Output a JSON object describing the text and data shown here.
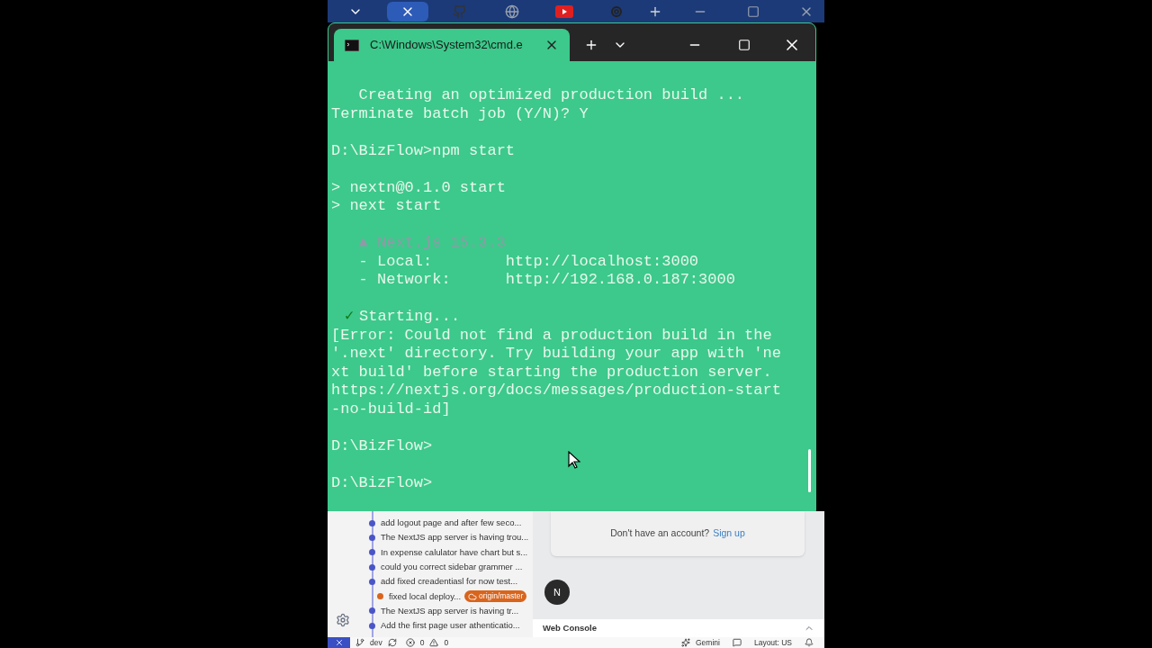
{
  "browser_tabs": [
    {
      "kind": "chevron",
      "selected": false
    },
    {
      "kind": "close",
      "selected": true
    },
    {
      "kind": "github",
      "selected": false
    },
    {
      "kind": "globe",
      "selected": false
    },
    {
      "kind": "youtube",
      "selected": false
    },
    {
      "kind": "knot",
      "selected": false
    }
  ],
  "terminal": {
    "tab_title": "C:\\Windows\\System32\\cmd.e",
    "blocks": [
      [
        {
          "kind": "normal",
          "text": "   Creating an optimized production build ..."
        },
        {
          "kind": "normal",
          "text": "Terminate batch job (Y/N)? Y"
        }
      ],
      [
        {
          "kind": "normal",
          "text": "D:\\BizFlow>npm start"
        }
      ],
      [
        {
          "kind": "normal",
          "text": "> nextn@0.1.0 start"
        },
        {
          "kind": "normal",
          "text": "> next start"
        }
      ],
      [
        {
          "kind": "faded",
          "text": "   ▲ Next.js 15.3.3"
        },
        {
          "kind": "normal",
          "text": "   - Local:        http://localhost:3000"
        },
        {
          "kind": "normal",
          "text": "   - Network:      http://192.168.0.187:3000"
        }
      ],
      [
        {
          "kind": "success",
          "mark": "✓",
          "text": "Starting..."
        },
        {
          "kind": "normal",
          "text": "[Error: Could not find a production build in the"
        },
        {
          "kind": "normal",
          "text": "'.next' directory. Try building your app with 'ne"
        },
        {
          "kind": "normal",
          "text": "xt build' before starting the production server."
        },
        {
          "kind": "normal",
          "text": "https://nextjs.org/docs/messages/production-start"
        },
        {
          "kind": "normal",
          "text": "-no-build-id]"
        }
      ],
      [
        {
          "kind": "normal",
          "text": "D:\\BizFlow>"
        }
      ],
      [
        {
          "kind": "normal",
          "text": "D:\\BizFlow>"
        }
      ]
    ]
  },
  "commits": [
    {
      "message": "add logout page and after few seco..."
    },
    {
      "message": "The NextJS app server is having trou..."
    },
    {
      "message": "In expense calulator have chart but s..."
    },
    {
      "message": "could you correct sidebar grammer ..."
    },
    {
      "message": "add fixed creadentiasl for now test..."
    },
    {
      "message": "fixed local deploy...",
      "branch": "origin/master"
    },
    {
      "message": "The NextJS app server is having tr..."
    },
    {
      "message": "Add the first page user athenticatio..."
    }
  ],
  "signup": {
    "prompt": "Don't have an account?",
    "link": "Sign up"
  },
  "avatar_letter": "N",
  "web_console": "Web Console",
  "status_bar": {
    "branch": "dev",
    "errors": "0",
    "warnings": "0",
    "assistant": "Gemini",
    "layout": "Layout: US"
  }
}
